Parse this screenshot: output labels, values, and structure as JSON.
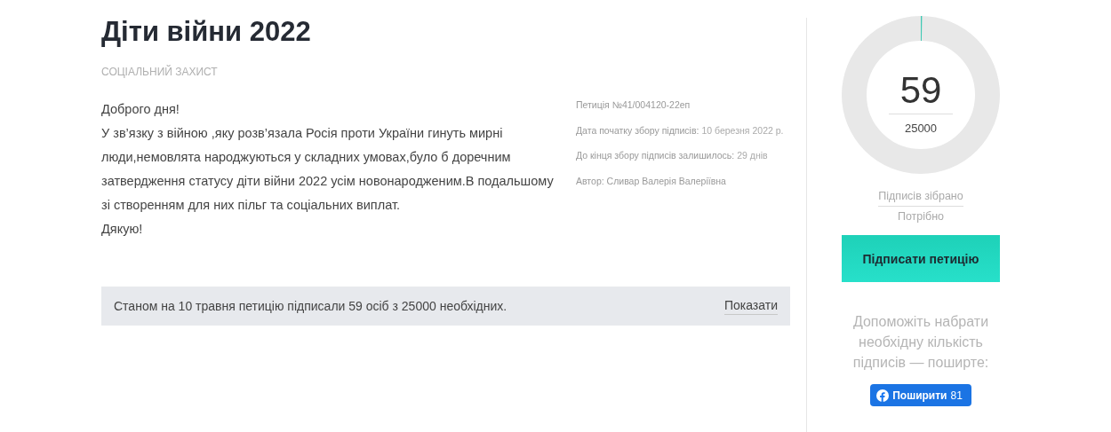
{
  "petition": {
    "title": "Діти війни 2022",
    "category": "СОЦІАЛЬНИЙ ЗАХИСТ",
    "body": [
      "Доброго дня!",
      "У зв’язку з війною ,яку розв’язала Росія проти України гинуть мирні люди,немовлята народжуються у складних умовах,було б доречним затвердження статусу діти війни 2022 усім новонародженим.В подальшому зі створенням для них пільг та соціальних виплат.",
      "Дякую!"
    ],
    "meta": [
      {
        "label": "Петиція №41/004120-22еп"
      },
      {
        "label": "Дата початку збору підписів:",
        "value": "10 березня 2022 р."
      },
      {
        "label": "До кінця збору підписів залишилось:",
        "value": "29 днів"
      },
      {
        "label": "Автор: Сливар Валерія Валеріївна"
      }
    ],
    "status": {
      "text": "Станом на 10 травня петицію підписали 59 осіб з 25000 необхідних.",
      "link": "Показати"
    }
  },
  "progress": {
    "level": 0.0024,
    "count": "59",
    "goal": "25000",
    "count_label": "Підписів зібрано",
    "goal_label": "Потрібно"
  },
  "sign_button": "Підписати петицію",
  "share": {
    "text": "Допоможіть набрати необхідну кількість підписів — поширте:",
    "button": "Поширити",
    "count": "81"
  }
}
